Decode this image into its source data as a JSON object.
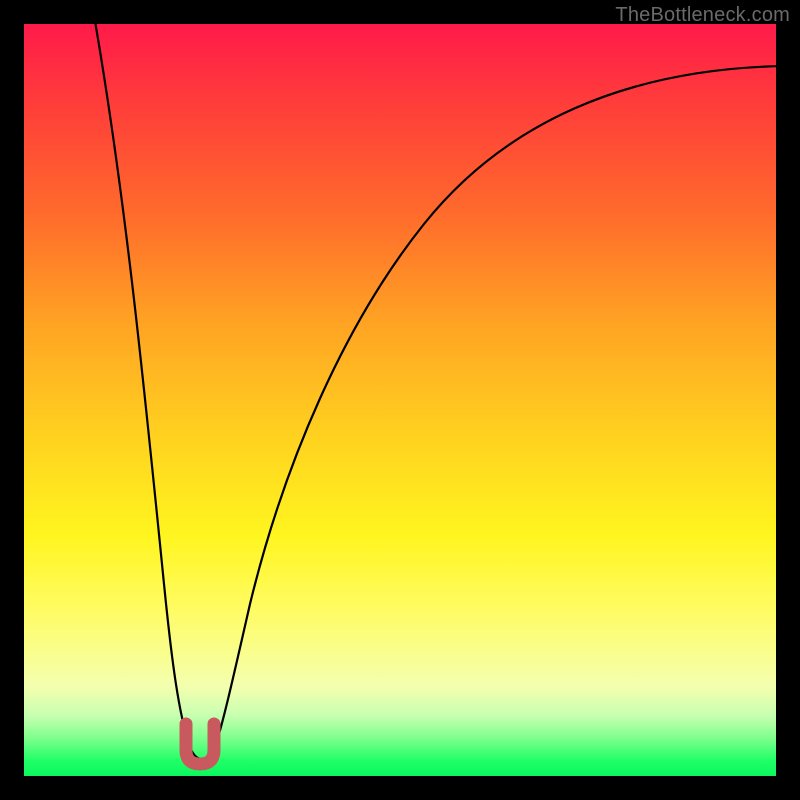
{
  "watermark": "TheBottleneck.com",
  "colors": {
    "frame_bg": "#000000",
    "curve_stroke": "#000000",
    "marker_fill": "#c85a5f",
    "marker_stroke": "#b94e53"
  },
  "chart_data": {
    "type": "line",
    "title": "",
    "xlabel": "",
    "ylabel": "",
    "xlim": [
      0,
      100
    ],
    "ylim": [
      0,
      100
    ],
    "x": [
      0,
      2,
      4,
      6,
      8,
      10,
      12,
      14,
      16,
      18,
      19,
      20,
      21,
      22,
      23,
      24,
      26,
      28,
      30,
      34,
      38,
      42,
      46,
      50,
      55,
      60,
      65,
      70,
      75,
      80,
      85,
      90,
      95,
      100
    ],
    "values": [
      103,
      95,
      87,
      79,
      71,
      63,
      55,
      46,
      36,
      22,
      14,
      7,
      3,
      1,
      1,
      3,
      11,
      22,
      31,
      44,
      54,
      61,
      67,
      72,
      77,
      80,
      83,
      85.5,
      87.5,
      89,
      90.3,
      91.4,
      92.3,
      93
    ],
    "minimum_marker": {
      "x": 22,
      "y": 1,
      "shape": "U"
    },
    "notes": "Values are bottleneck percentages read from a gradient plot; 0 = bottom (green, no bottleneck), 100 = top (red). The curve dips to ~0 at x≈22 and rises toward ~93 at x=100."
  }
}
